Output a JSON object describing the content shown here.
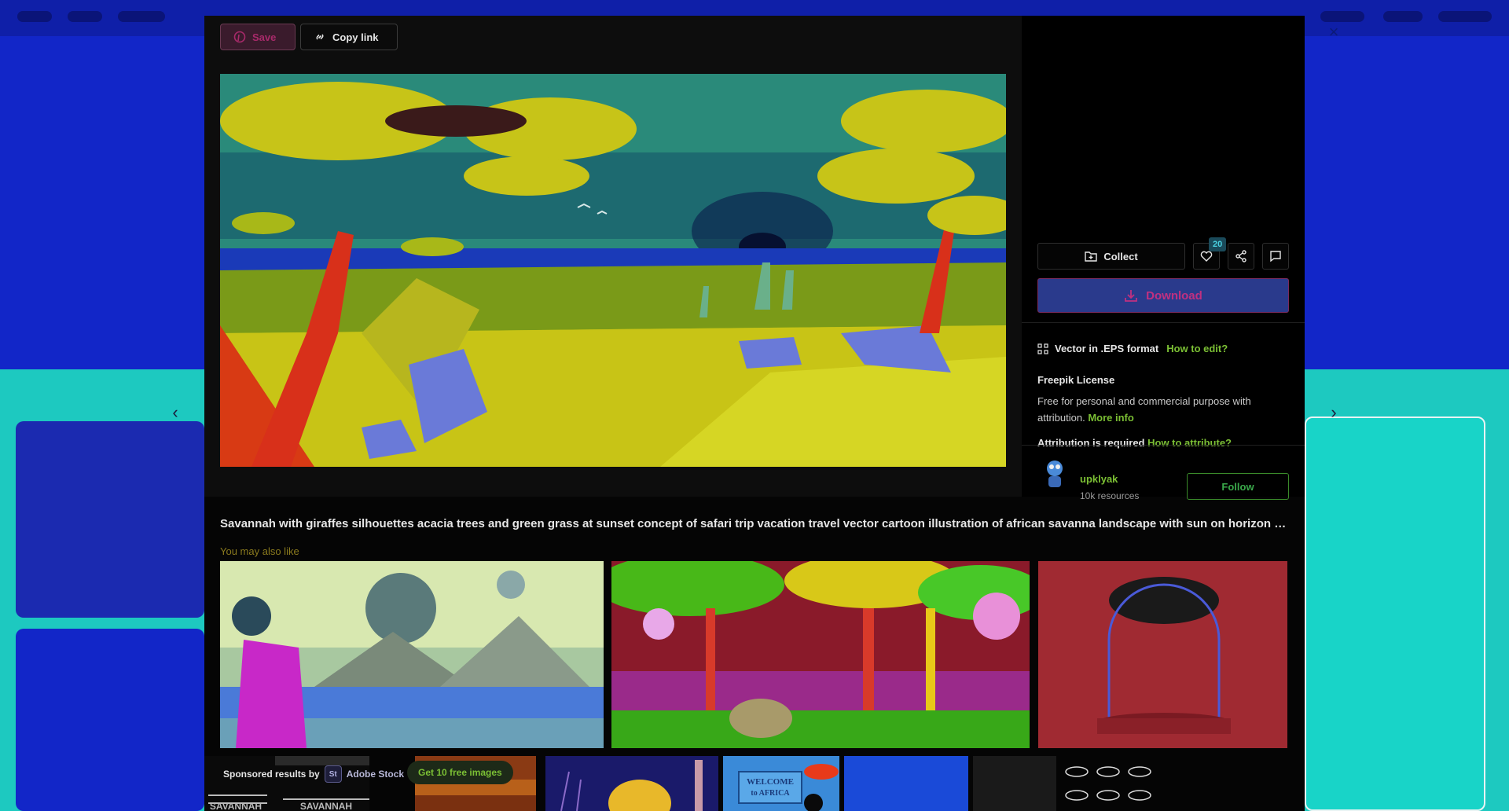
{
  "modal": {
    "save_label": "Save",
    "copy_link_label": "Copy link",
    "collect_label": "Collect",
    "like_count": "20",
    "download_label": "Download",
    "vector_format": "Vector in .EPS format",
    "how_to_edit": "How to edit?",
    "license_title": "Freepik License",
    "license_text": "Free for personal and commercial purpose with attribution.",
    "more_info": "More info",
    "attribution_required": "Attribution is required",
    "how_to_attribute": "How to attribute?",
    "author_name": "upklyak",
    "author_resources": "10k resources",
    "follow_label": "Follow",
    "description": "Savannah with giraffes silhouettes acacia trees and green grass at sunset concept of safari trip vacation travel vector cartoon illustration of african savanna landscape with sun on horizon Fr...",
    "also_like_label": "You may also like",
    "sponsored_label": "Sponsored results by",
    "adobe_stock": "Adobe Stock",
    "free_images": "Get 10 free images",
    "sponsored_caption_1": "SAVANNAH",
    "sponsored_caption_2": "SAVANNAH",
    "sponsored_caption_3": "WELCOME",
    "sponsored_caption_4": "to AFRICA"
  },
  "icons": [
    "pinterest-icon",
    "link-icon",
    "folder-plus-icon",
    "heart-icon",
    "share-icon",
    "comment-icon",
    "download-icon",
    "vector-icon",
    "chevron-left-icon",
    "chevron-right-icon",
    "close-icon"
  ],
  "colors": {
    "accent_green": "#7bbf34",
    "download_bg": "#2a3a8c",
    "modal_bg": "#050505"
  }
}
